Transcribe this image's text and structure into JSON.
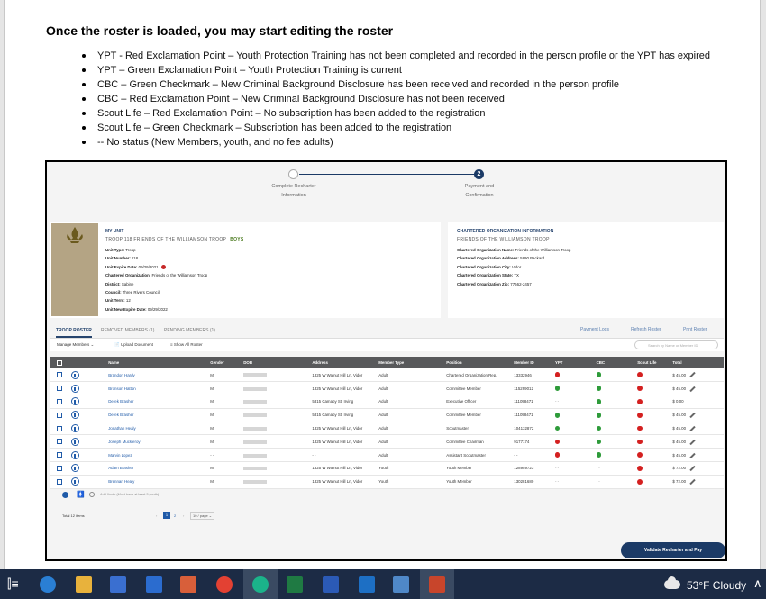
{
  "document": {
    "title": "Once the roster is loaded, you may start editing the roster",
    "bullets": [
      "YPT - Red Exclamation Point – Youth Protection Training has not been completed and recorded in the person profile or the YPT has expired",
      "YPT – Green Exclamation Point – Youth Protection Training is current",
      "CBC – Green Checkmark – New Criminal Background Disclosure has been received and recorded in the person profile",
      "CBC – Red Exclamation Point – New Criminal Background Disclosure has not been received",
      "Scout Life – Red Exclamation Point – No subscription has been added to the registration",
      "Scout Life – Green Checkmark – Subscription has been added to the registration",
      "-- No status (New Members, youth, and no fee adults)"
    ]
  },
  "stepper": {
    "step1_label": "Complete Recharter Information",
    "step2_number": "2",
    "step2_label": "Payment and Confirmation"
  },
  "unit": {
    "section_title": "MY UNIT",
    "name": "TROOP 118 FRIENDS OF THE WILLIAMSON TROOP",
    "badge": "BOYS",
    "fields": [
      {
        "label": "Unit Type:",
        "value": "Troop"
      },
      {
        "label": "Unit Number:",
        "value": "118"
      },
      {
        "label": "Unit Expire Date:",
        "value": "09/29/2021"
      },
      {
        "label": "Chartered Organization:",
        "value": "Friends of the Williamson Troop"
      },
      {
        "label": "District:",
        "value": "Sabine"
      },
      {
        "label": "Council:",
        "value": "Three Rivers Council"
      },
      {
        "label": "Unit Term:",
        "value": "12"
      },
      {
        "label": "Unit New Expire Date:",
        "value": "09/29/2022"
      }
    ]
  },
  "org": {
    "section_title": "CHARTERED ORGANIZATION INFORMATION",
    "name": "FRIENDS OF THE WILLIAMSON TROOP",
    "fields": [
      {
        "label": "Chartered Organization Name:",
        "value": "Friends of the Williamson Troop"
      },
      {
        "label": "Chartered Organization Address:",
        "value": "5890 Packard"
      },
      {
        "label": "Chartered Organization City:",
        "value": "Vidor"
      },
      {
        "label": "Chartered Organization State:",
        "value": "TX"
      },
      {
        "label": "Chartered Organization Zip:",
        "value": "77662-2457"
      }
    ]
  },
  "tabs": {
    "roster": "TROOP ROSTER",
    "removed": "REMOVED MEMBERS (1)",
    "pending": "PENDING MEMBERS (1)"
  },
  "links": {
    "payment_logs": "Payment Logs",
    "refresh_roster": "Refresh Roster",
    "print_roster": "Print Roster"
  },
  "toolbar": {
    "manage_members": "Manage Members",
    "upload_document": "Upload Document",
    "show_all_roster": "Show All Roster",
    "search_placeholder": "Search by Name or Member ID"
  },
  "table": {
    "headers": [
      "Name",
      "Gender",
      "DOB",
      "Address",
      "Member Type",
      "Position",
      "Member ID",
      "YPT",
      "CBC",
      "Scout Life",
      "Total"
    ],
    "rows": [
      {
        "name": "Brandon Hardy",
        "gender": "M",
        "address": "1325 W Walnut Hill Ln, Vidor",
        "type": "Adult",
        "position": "Chartered Organization Rep.",
        "id": "13332946",
        "ypt": "red",
        "cbc": "green",
        "sl": "red",
        "total": "$ 45.00",
        "edit": true
      },
      {
        "name": "Bronson Hatton",
        "gender": "M",
        "address": "1325 W Walnut Hill Ln, Vidor",
        "type": "Adult",
        "position": "Committee Member",
        "id": "115299012",
        "ypt": "green",
        "cbc": "green",
        "sl": "red",
        "total": "$ 45.00",
        "edit": true
      },
      {
        "name": "Derek Brasher",
        "gender": "M",
        "address": "5315 Camaby St, Irving",
        "type": "Adult",
        "position": "Executive Officer",
        "id": "111098471",
        "ypt": "none",
        "cbc": "green",
        "sl": "red",
        "total": "$ 0.00",
        "edit": false
      },
      {
        "name": "Derek Brasher",
        "gender": "M",
        "address": "5315 Camaby St, Irving",
        "type": "Adult",
        "position": "Committee Member",
        "id": "111098471",
        "ypt": "green",
        "cbc": "green",
        "sl": "red",
        "total": "$ 45.00",
        "edit": true
      },
      {
        "name": "Jonathan Healy",
        "gender": "M",
        "address": "1325 W Walnut Hill Ln, Vidor",
        "type": "Adult",
        "position": "Scoutmaster",
        "id": "104132872",
        "ypt": "green",
        "cbc": "green",
        "sl": "red",
        "total": "$ 45.00",
        "edit": true
      },
      {
        "name": "Joseph Muckleroy",
        "gender": "M",
        "address": "1325 W Walnut Hill Ln, Vidor",
        "type": "Adult",
        "position": "Committee Chairman",
        "id": "9177174",
        "ypt": "red",
        "cbc": "green",
        "sl": "red",
        "total": "$ 45.00",
        "edit": true
      },
      {
        "name": "Marvin Lopez",
        "gender": "- -",
        "address": "- -",
        "type": "Adult",
        "position": "Assistant Scoutmaster",
        "id": "- -",
        "ypt": "red",
        "cbc": "green",
        "sl": "red",
        "total": "$ 45.00",
        "edit": true
      },
      {
        "name": "Adam Brasher",
        "gender": "M",
        "address": "1325 W Walnut Hill Ln, Vidor",
        "type": "Youth",
        "position": "Youth Member",
        "id": "128959723",
        "ypt": "none",
        "cbc": "none",
        "sl": "red",
        "total": "$ 72.00",
        "edit": true
      },
      {
        "name": "Brennan Healy",
        "gender": "M",
        "address": "1325 W Walnut Hill Ln, Vidor",
        "type": "Youth",
        "position": "Youth Member",
        "id": "130281680",
        "ypt": "none",
        "cbc": "none",
        "sl": "red",
        "total": "$ 72.00",
        "edit": true
      }
    ]
  },
  "footer": {
    "add_youth": "Add Youth (Must have at least 5 youth)",
    "total_items": "Total 12 items",
    "page_1": "1",
    "page_2": "2",
    "page_size": "10 / page",
    "validate_button": "Validate Recharter and Pay"
  },
  "taskbar": {
    "weather": "53°F  Cloudy"
  },
  "colors": {
    "brand_navy": "#1b3a66",
    "status_red": "#d42020",
    "status_green": "#2e9b3a",
    "header_gray": "#58595b"
  }
}
